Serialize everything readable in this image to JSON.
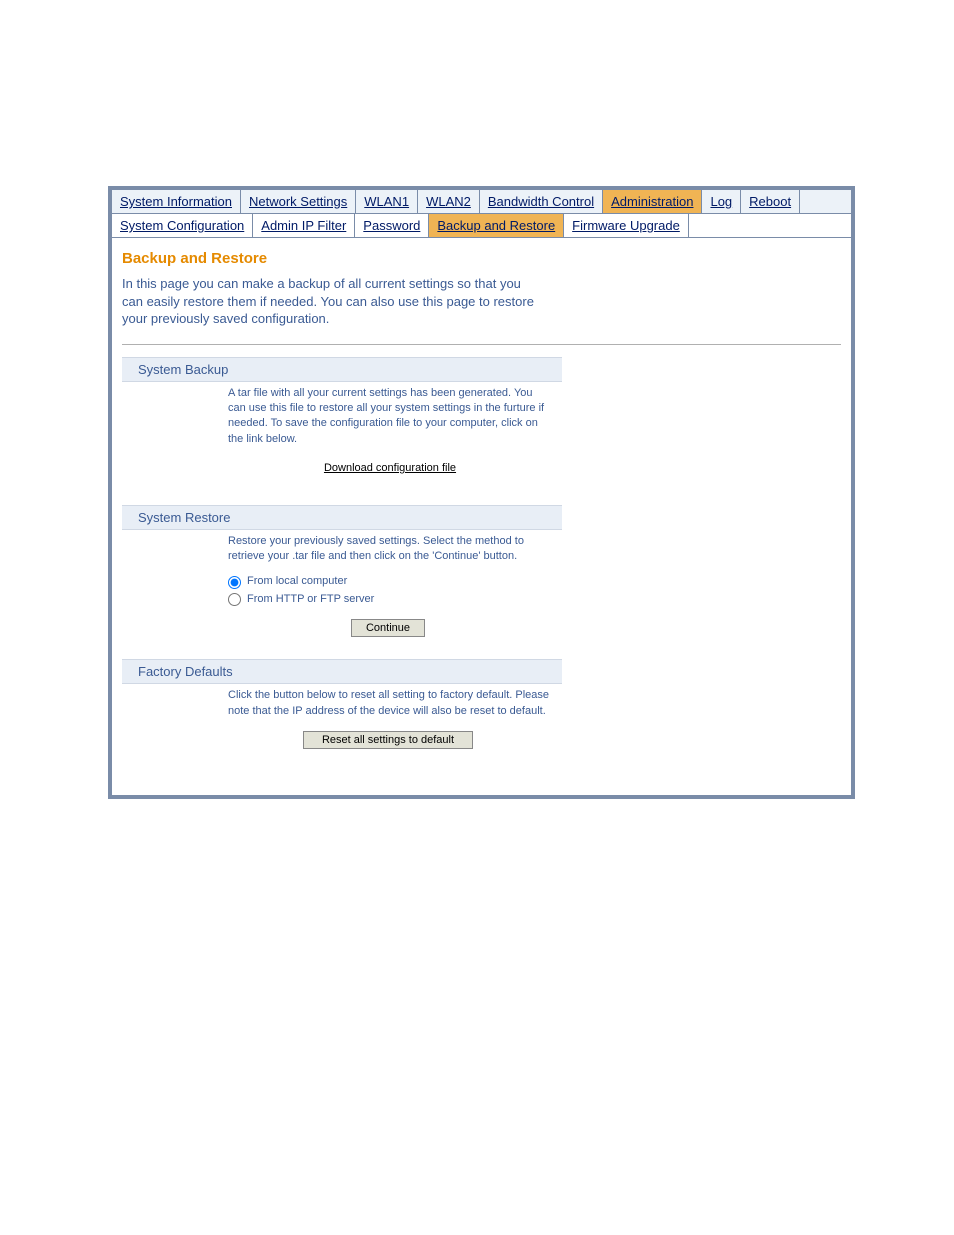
{
  "tabs": {
    "main": [
      {
        "label": "System Information",
        "active": false
      },
      {
        "label": "Network Settings",
        "active": false
      },
      {
        "label": "WLAN1",
        "active": false
      },
      {
        "label": "WLAN2",
        "active": false
      },
      {
        "label": "Bandwidth Control",
        "active": false
      },
      {
        "label": "Administration",
        "active": true
      },
      {
        "label": "Log",
        "active": false
      },
      {
        "label": "Reboot",
        "active": false
      }
    ],
    "sub": [
      {
        "label": "System Configuration",
        "active": false
      },
      {
        "label": "Admin IP Filter",
        "active": false
      },
      {
        "label": "Password",
        "active": false
      },
      {
        "label": "Backup and Restore",
        "active": true
      },
      {
        "label": "Firmware Upgrade",
        "active": false
      }
    ]
  },
  "page": {
    "title": "Backup and Restore",
    "description": "In this page you can make a backup of all current settings so that you can easily restore them if needed. You can also use this page to restore your previously saved configuration."
  },
  "backup": {
    "header": "System Backup",
    "text": "A tar file with all your current settings has been generated. You can use this file to restore all your system settings in the furture if needed. To save the configuration file to your computer, click on the link below.",
    "download_label": "Download configuration file"
  },
  "restore": {
    "header": "System Restore",
    "text": "Restore your previously saved settings. Select the method to retrieve your .tar file and then click on the 'Continue' button.",
    "option_local": "From local computer",
    "option_http": "From HTTP or FTP server",
    "continue_label": "Continue",
    "selected": "local"
  },
  "defaults": {
    "header": "Factory Defaults",
    "text": "Click the button below to reset all setting to factory default. Please note that the IP address of the device will also be reset to default.",
    "reset_label": "Reset all settings to default"
  }
}
